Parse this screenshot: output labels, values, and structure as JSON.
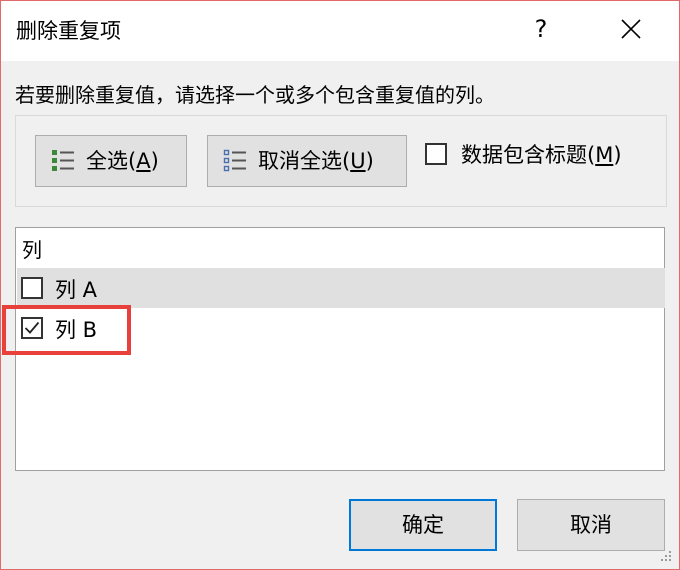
{
  "dialog": {
    "title": "删除重复项",
    "help": "?",
    "instruction": "若要删除重复值，请选择一个或多个包含重复值的列。"
  },
  "toolbar": {
    "select_all": {
      "text": "全选(",
      "key": "A",
      "end": ")"
    },
    "unselect_all": {
      "text": "取消全选(",
      "key": "U",
      "end": ")"
    },
    "header_checkbox": {
      "text": "数据包含标题(",
      "key": "M",
      "end": ")",
      "checked": false
    }
  },
  "list": {
    "header": "列",
    "rows": [
      {
        "label": "列 A",
        "checked": false,
        "selected": true
      },
      {
        "label": "列 B",
        "checked": true,
        "selected": false
      }
    ]
  },
  "footer": {
    "ok": "确定",
    "cancel": "取消"
  },
  "colors": {
    "highlight": "#e8403a",
    "default_button_border": "#0078d7",
    "window_border": "#e06a6a"
  }
}
